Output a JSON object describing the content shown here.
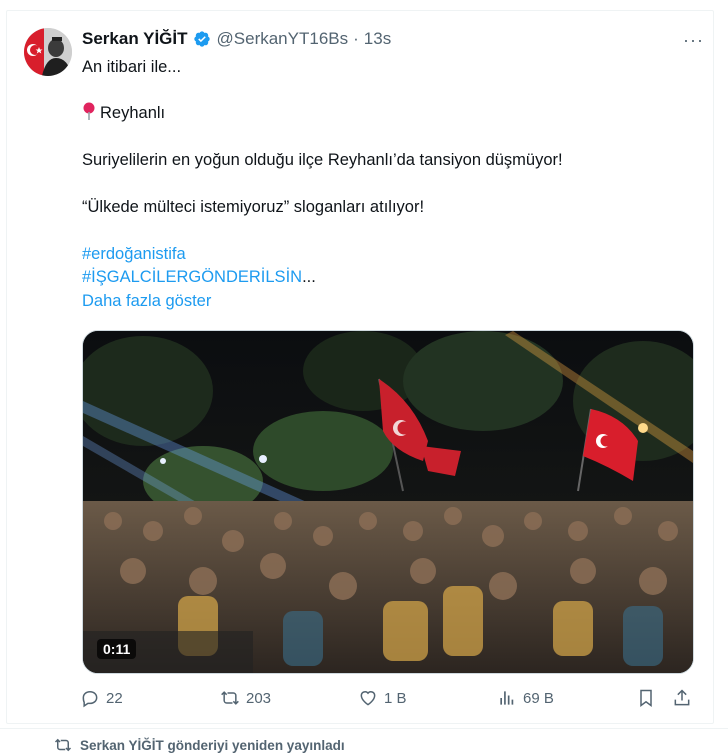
{
  "tweet": {
    "author_name": "Serkan YİĞİT",
    "handle": "@SerkanYT16Bs",
    "separator": "·",
    "time": "13s",
    "more": "···",
    "lines": {
      "l1": "An itibari ile...",
      "l2": "Reyhanlı",
      "l3": "Suriyelilerin en yoğun olduğu ilçe Reyhanlı’da tansiyon düşmüyor!",
      "l4": "“Ülkede mülteci istemiyoruz” sloganları atılıyor!",
      "hashtag1": "#erdoğanistifa",
      "hashtag2": "#İŞGALCİLERGÖNDERİLSİN",
      "ellipsis": "...",
      "show_more": "Daha fazla göster"
    },
    "video_duration": "0:11",
    "stats": {
      "replies": "22",
      "reposts": "203",
      "likes": "1 B",
      "views": "69 B"
    }
  },
  "next": {
    "repost_text": "Serkan YİĞİT gönderiyi yeniden yayınladı"
  },
  "colors": {
    "accent": "#1d9bf0",
    "muted": "#536471",
    "text": "#0f1419",
    "flag_red": "#d81e2c"
  }
}
